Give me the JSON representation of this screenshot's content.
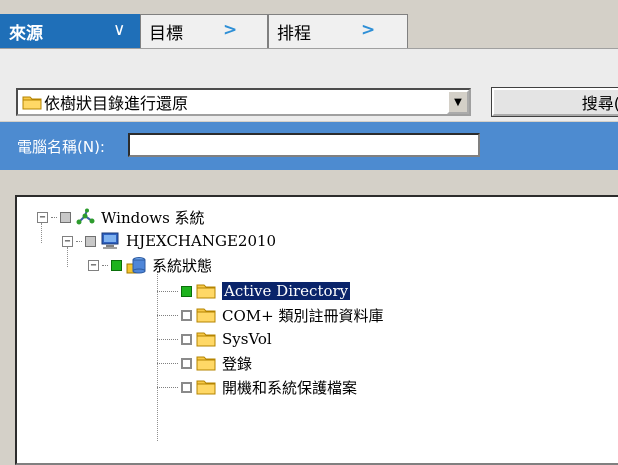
{
  "tabs": [
    {
      "label": "來源",
      "active": true
    },
    {
      "label": "目標",
      "active": false
    },
    {
      "label": "排程",
      "active": false
    }
  ],
  "restore_mode": {
    "selected": "依樹狀目錄進行還原"
  },
  "search_button": {
    "label": "搜尋("
  },
  "computer_name": {
    "label": "電腦名稱(N):",
    "value": ""
  },
  "tree": {
    "nodes": [
      {
        "label": "Windows 系統",
        "expander": "−",
        "icon": "network-icon"
      },
      {
        "label": "HJEXCHANGE2010",
        "expander": "−",
        "icon": "computer-icon"
      },
      {
        "label": "系統狀態",
        "expander": "−",
        "icon": "database-icon"
      },
      {
        "label": "Active Directory",
        "icon": "folder-icon",
        "selected": true
      },
      {
        "label": "COM+ 類別註冊資料庫",
        "icon": "folder-icon"
      },
      {
        "label": "SysVol",
        "icon": "folder-icon"
      },
      {
        "label": "登錄",
        "icon": "folder-icon"
      },
      {
        "label": "開機和系統保護檔案",
        "icon": "folder-icon"
      }
    ]
  },
  "colors": {
    "accent": "#1f6fb8",
    "band": "#4d8bd0",
    "checked": "#1eb31e",
    "selection": "#0a246a"
  }
}
